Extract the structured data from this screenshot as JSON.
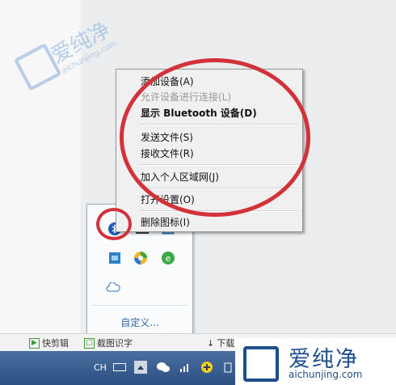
{
  "context_menu": {
    "items": [
      {
        "label": "添加设备(A)",
        "state": "normal"
      },
      {
        "label": "允许设备进行连接(L)",
        "state": "disabled"
      },
      {
        "label": "显示 Bluetooth 设备(D)",
        "state": "bold"
      },
      {
        "label": "发送文件(S)",
        "state": "normal"
      },
      {
        "label": "接收文件(R)",
        "state": "normal"
      },
      {
        "label": "加入个人区域网(J)",
        "state": "normal"
      },
      {
        "label": "打开设置(O)",
        "state": "normal"
      },
      {
        "label": "删除图标(I)",
        "state": "normal"
      }
    ]
  },
  "tray_popup": {
    "customize_label": "自定义..."
  },
  "toolbar": {
    "items": [
      "快剪辑",
      "截图识字",
      "下载"
    ]
  },
  "taskbar": {
    "language": "CH"
  },
  "watermark": {
    "brand_cn": "爱纯净",
    "brand_url": "aichunjing.com"
  },
  "colors": {
    "annotation_red": "#d2333a",
    "bluetooth_blue": "#1e5bb8",
    "link_blue": "#2b62a3"
  }
}
